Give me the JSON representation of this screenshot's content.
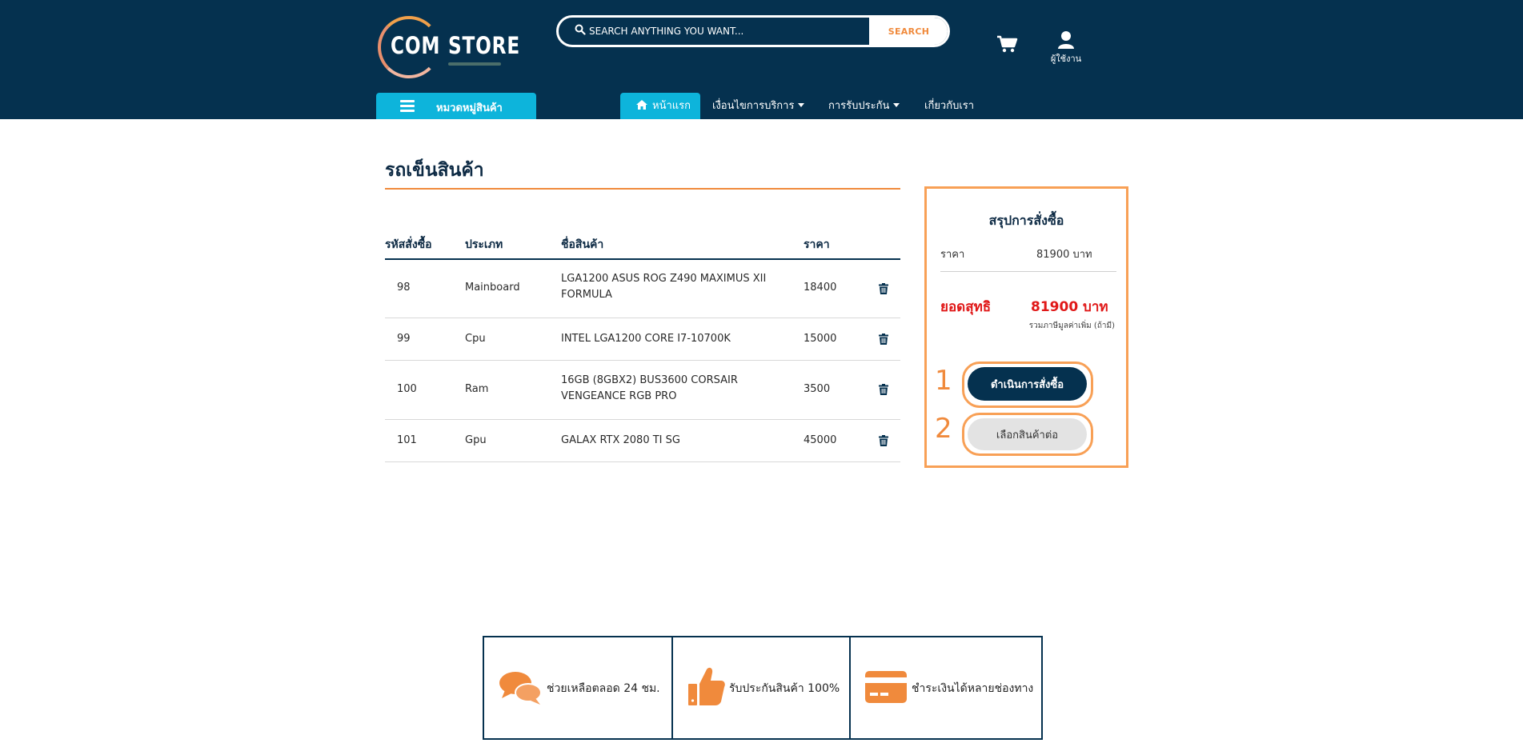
{
  "header": {
    "logo": {
      "word1": "COM",
      "word2": "STORE"
    },
    "search": {
      "placeholder": "SEARCH ANYTHING YOU WANT...",
      "button_label": "SEARCH"
    },
    "user_label": "ผู้ใช้งาน",
    "category_button_label": "หมวดหมู่สินค้า",
    "nav": {
      "home": "หน้าแรก",
      "terms": "เงื่อนไขการบริการ",
      "warranty": "การรับประกัน",
      "about": "เกี่ยวกับเรา"
    }
  },
  "cart": {
    "title": "รถเข็นสินค้า",
    "columns": [
      "รหัสสั่งซื้อ",
      "ประเภท",
      "ชื่อสินค้า",
      "ราคา"
    ],
    "rows": [
      {
        "id": "98",
        "type": "Mainboard",
        "name": "LGA1200 ASUS ROG Z490 MAXIMUS XII FORMULA",
        "price": "18400"
      },
      {
        "id": "99",
        "type": "Cpu",
        "name": "INTEL LGA1200 CORE I7-10700K",
        "price": "15000"
      },
      {
        "id": "100",
        "type": "Ram",
        "name": "16GB (8GBX2) BUS3600 CORSAIR VENGEANCE RGB PRO",
        "price": "3500"
      },
      {
        "id": "101",
        "type": "Gpu",
        "name": "GALAX RTX 2080 TI SG",
        "price": "45000"
      }
    ]
  },
  "summary": {
    "title": "สรุปการสั่งซื้อ",
    "price_label": "ราคา",
    "price_value": "81900 บาท",
    "net_label": "ยอดสุทธิ",
    "net_value": "81900 บาท",
    "vat_note": "รวมภาษีมูลค่าเพิ่ม (ถ้ามี)",
    "annotation_1": "1",
    "annotation_2": "2",
    "order_button": "ดำเนินการสั่งซื้อ",
    "continue_button": "เลือกสินค้าต่อ"
  },
  "features": [
    {
      "icon": "chat-icon",
      "text": "ช่วยเหลือตลอด 24 ชม."
    },
    {
      "icon": "thumbs-up-icon",
      "text": "รับประกันสินค้า 100%"
    },
    {
      "icon": "credit-card-icon",
      "text": "ชำระเงินได้หลายช่องทาง"
    }
  ],
  "colors": {
    "header_bg": "#05314f",
    "accent_cyan": "#0db4db",
    "accent_orange": "#f08a3c",
    "net_red": "#e01818"
  }
}
